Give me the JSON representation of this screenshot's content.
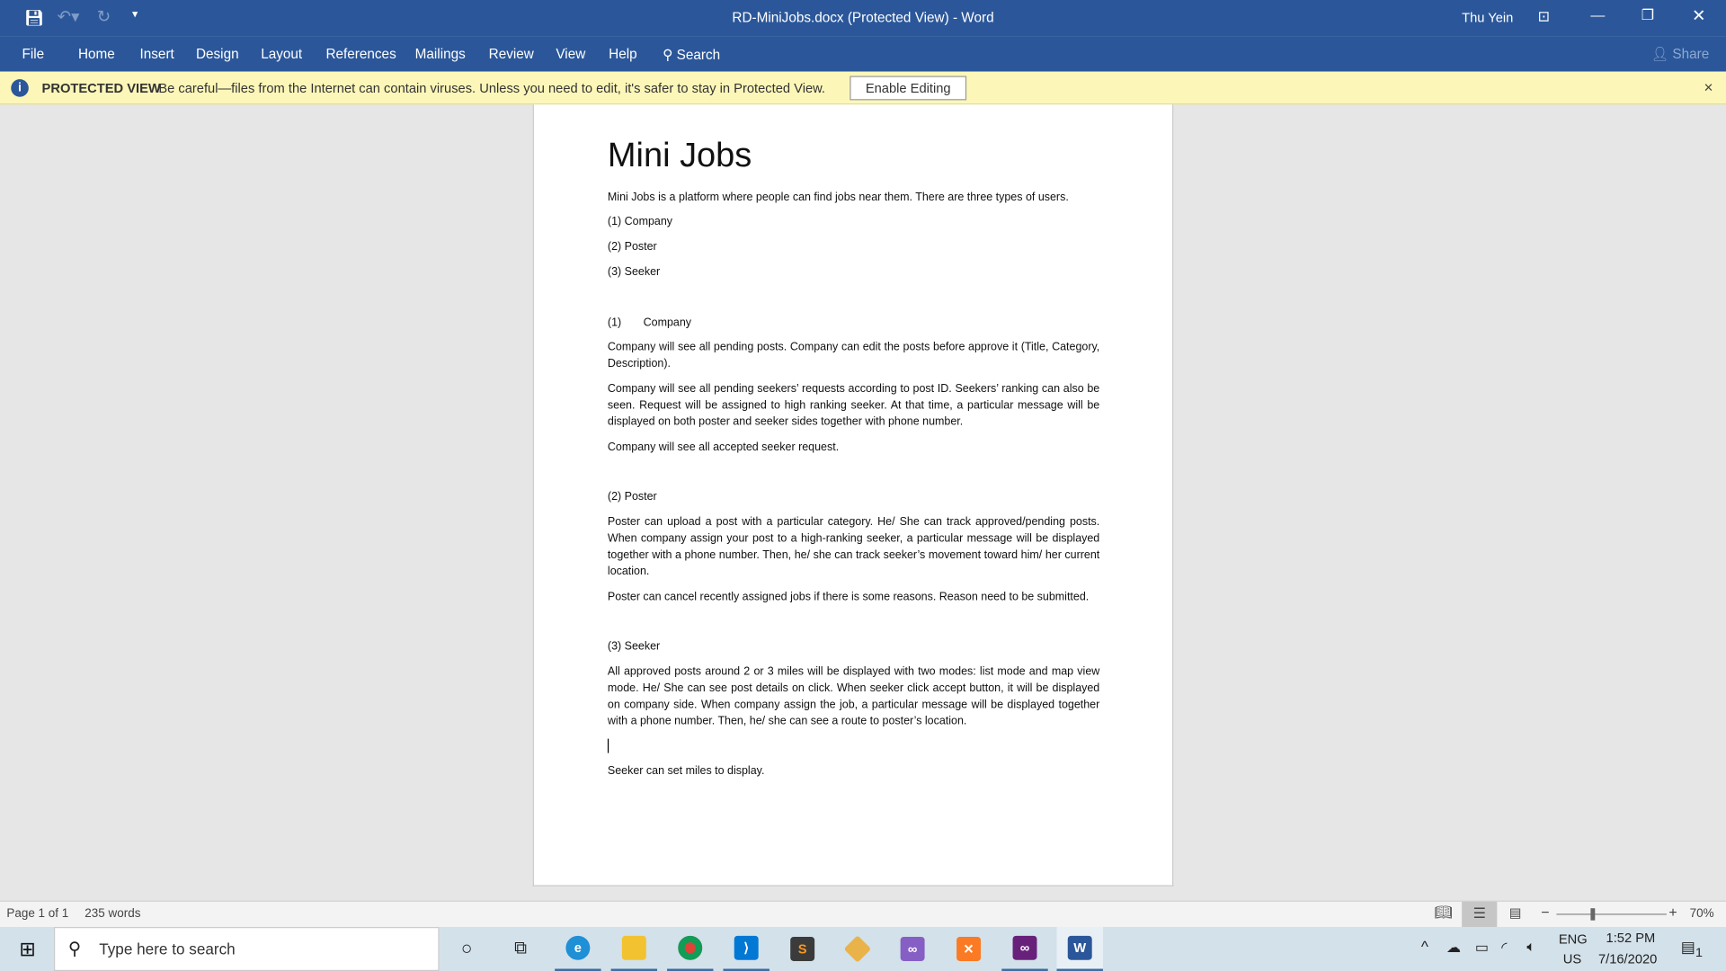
{
  "window": {
    "title": "RD-MiniJobs.docx (Protected View)  -  Word",
    "user": "Thu Yein",
    "share": "Share"
  },
  "ribbon": {
    "tabs": [
      "File",
      "Home",
      "Insert",
      "Design",
      "Layout",
      "References",
      "Mailings",
      "Review",
      "View",
      "Help"
    ],
    "search": "Search"
  },
  "protected": {
    "label": "PROTECTED VIEW",
    "message": "Be careful—files from the Internet can contain viruses. Unless you need to edit, it's safer to stay in Protected View.",
    "button": "Enable Editing",
    "close": "×"
  },
  "document": {
    "title": "Mini Jobs",
    "intro": "Mini Jobs is a platform where people can find jobs near them. There are three types of users.",
    "list": [
      "(1) Company",
      "(2) Poster",
      "(3) Seeker"
    ],
    "s1_num": "(1)",
    "s1_head": "Company",
    "s1_p1": "Company will see all pending posts. Company can edit the posts before approve it (Title, Category, Description).",
    "s1_p2": "Company will see all pending seekers’ requests according to post ID. Seekers’ ranking can also be seen. Request will be assigned to high ranking seeker. At that time, a particular message will be displayed on both poster and seeker sides together with phone number.",
    "s1_p3": "Company will see all accepted seeker request.",
    "s2_head": "(2) Poster",
    "s2_p1": "Poster can upload a post with a particular category. He/ She can track approved/pending posts. When company assign your post to a high-ranking seeker, a particular message will be displayed together with a phone number. Then, he/ she can track seeker’s movement toward him/ her current location.",
    "s2_p2": "Poster can cancel recently assigned jobs if there is some reasons. Reason need to be submitted.",
    "s3_head": "(3) Seeker",
    "s3_p1": "All approved posts around 2 or 3 miles will be displayed with two modes: list mode and map view mode. He/ She can see post details on click. When seeker click accept button, it will be displayed on company side. When company assign the job, a particular message will be displayed together with a phone number. Then, he/ she can see a route to poster’s location.",
    "s3_p2": "Seeker can set miles to display."
  },
  "status": {
    "page": "Page 1 of 1",
    "words": "235 words",
    "zoom": "70%",
    "zoom_percent": 70
  },
  "taskbar": {
    "search_placeholder": "Type here to search",
    "lang1": "ENG",
    "lang2": "US",
    "time": "1:52 PM",
    "date": "7/16/2020",
    "notifications": "1"
  },
  "colors": {
    "ribbon": "#2b579a",
    "protected_bar": "#fcf7b8",
    "taskbar": "#d3e1ea"
  }
}
